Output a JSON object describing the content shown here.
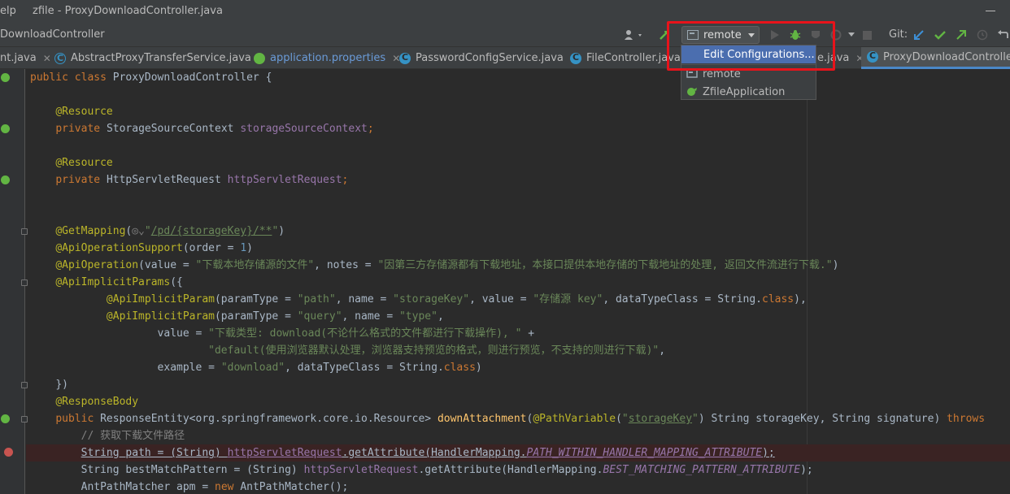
{
  "window": {
    "menu_fragment": "elp",
    "title": "zfile - ProxyDownloadController.java"
  },
  "breadcrumb": "DownloadController",
  "run_config": {
    "current": "remote"
  },
  "git_label": "Git:",
  "tabs": [
    {
      "label": "nt.java"
    },
    {
      "label": "AbstractProxyTransferService.java"
    },
    {
      "label": "application.properties"
    },
    {
      "label": "PasswordConfigService.java"
    },
    {
      "label": "FileController.java"
    },
    {
      "label": "e.java"
    },
    {
      "label": "ProxyDownloadController.java"
    }
  ],
  "dropdown": {
    "items": [
      {
        "label": "Edit Configurations..."
      },
      {
        "label": "remote"
      },
      {
        "label": "ZfileApplication"
      }
    ]
  },
  "code": {
    "l1": {
      "kw": "public class ",
      "name": "ProxyDownloadController {"
    },
    "l3": "@Resource",
    "l4": {
      "kw": "private ",
      "type": "StorageSourceContext ",
      "field": "storageSourceContext",
      "end": ";"
    },
    "l6": "@Resource",
    "l7": {
      "kw": "private ",
      "type": "HttpServletRequest ",
      "field": "httpServletRequest",
      "end": ";"
    },
    "l10": {
      "ann": "@GetMapping",
      "open": "(",
      "icon": "◎⌄",
      "str1": "\"",
      "str2": "/pd/{storageKey}/**",
      "str3": "\"",
      "close": ")"
    },
    "l11": {
      "ann": "@ApiOperationSupport",
      "p1": "(order = ",
      "num": "1",
      "p2": ")"
    },
    "l12": {
      "ann": "@ApiOperation",
      "p1": "(value = ",
      "s1": "\"下载本地存储源的文件\"",
      "p2": ", notes = ",
      "s2": "\"因第三方存储源都有下载地址，本接口提供本地存储的下载地址的处理, 返回文件流进行下载.\"",
      "p3": ")"
    },
    "l13": {
      "ann": "@ApiImplicitParams",
      "p1": "({"
    },
    "l14": {
      "ann": "@ApiImplicitParam",
      "p1": "(paramType = ",
      "s1": "\"path\"",
      "p2": ", name = ",
      "s2": "\"storageKey\"",
      "p3": ", value = ",
      "s3": "\"存储源 key\"",
      "p4": ", dataTypeClass = String.",
      "kw": "class",
      "p5": "),"
    },
    "l15": {
      "ann": "@ApiImplicitParam",
      "p1": "(paramType = ",
      "s1": "\"query\"",
      "p2": ", name = ",
      "s2": "\"type\"",
      "p3": ","
    },
    "l16": {
      "p1": "value = ",
      "s1": "\"下载类型: download(不论什么格式的文件都进行下载操作), \"",
      "p2": " +"
    },
    "l17": {
      "s1": "\"default(使用浏览器默认处理，浏览器支持预览的格式，则进行预览，不支持的则进行下载)\"",
      "p1": ","
    },
    "l18": {
      "p1": "example = ",
      "s1": "\"download\"",
      "p2": ", dataTypeClass = String.",
      "kw": "class",
      "p3": ")"
    },
    "l19": "})",
    "l20": "@ResponseBody",
    "l21": {
      "kw1": "public ",
      "p1": "ResponseEntity<org.springframework.core.io.Resource> ",
      "meth": "downAttachment",
      "p2": "(",
      "ann": "@PathVariable",
      "p3": "(",
      "s1a": "\"",
      "s1b": "storageKey",
      "s1c": "\"",
      "p4": ") String storageKey, String signature) ",
      "kw2": "throws"
    },
    "l22": "// 获取下载文件路径",
    "l23": {
      "p1": "String path = (String) ",
      "field": "httpServletRequest",
      "p2": ".getAttribute(HandlerMapping.",
      "sfld": "PATH_WITHIN_HANDLER_MAPPING_ATTRIBUTE",
      "p3": ");"
    },
    "l24": {
      "p1": "String bestMatchPattern = (String) ",
      "field": "httpServletRequest",
      "p2": ".getAttribute(HandlerMapping.",
      "sfld": "BEST_MATCHING_PATTERN_ATTRIBUTE",
      "p3": ");"
    },
    "l25": {
      "p1": "AntPathMatcher apm = ",
      "kw": "new ",
      "p2": "AntPathMatcher();"
    }
  },
  "colors": {
    "highlight": "#e8131b",
    "selection": "#4b6eaf",
    "accent": "#4a88c7"
  }
}
